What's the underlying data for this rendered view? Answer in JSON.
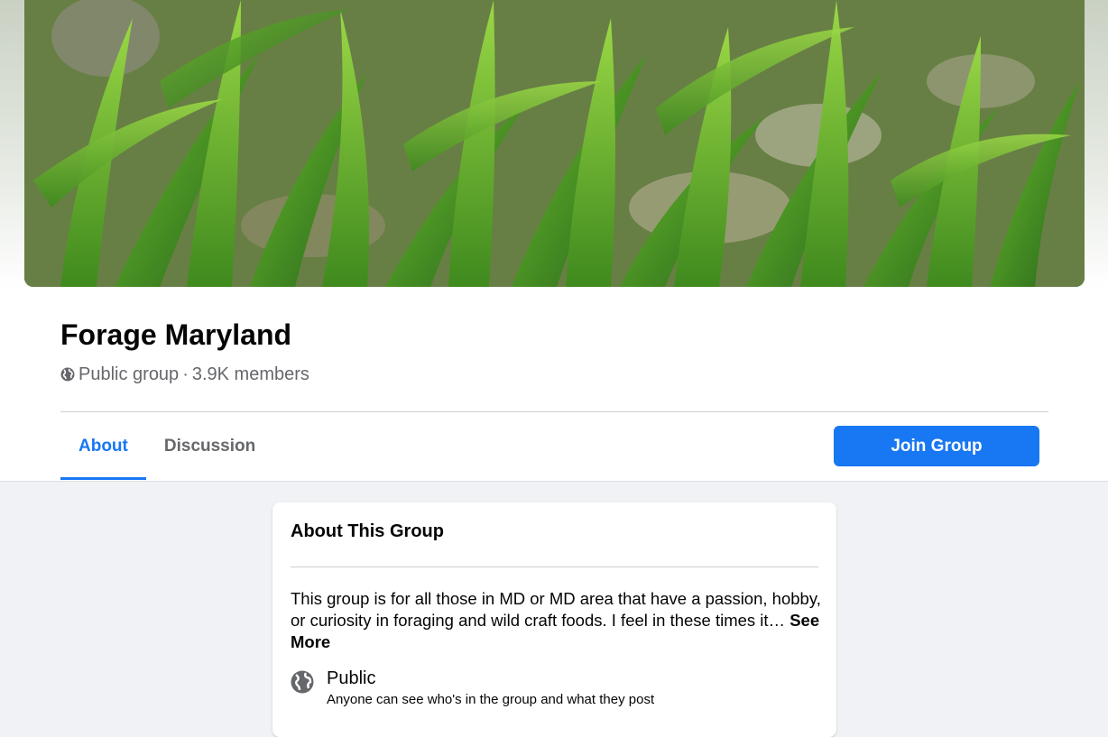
{
  "group": {
    "name": "Forage Maryland",
    "privacy_label": "Public group",
    "separator": "·",
    "members": "3.9K members"
  },
  "tabs": [
    {
      "label": "About",
      "active": true
    },
    {
      "label": "Discussion",
      "active": false
    }
  ],
  "actions": {
    "join_label": "Join Group"
  },
  "about": {
    "heading": "About This Group",
    "description": "This group is for all those in MD or MD area that have a passion, hobby, or curiosity in foraging and wild craft foods. I feel in these times it…",
    "see_more": "See More",
    "privacy": {
      "title": "Public",
      "description": "Anyone can see who's in the group and what they post"
    }
  },
  "colors": {
    "accent": "#1877f2",
    "secondary_text": "#65676b",
    "background": "#f0f2f5"
  },
  "icons": {
    "privacy_small": "globe-icon",
    "privacy_large": "globe-icon"
  }
}
